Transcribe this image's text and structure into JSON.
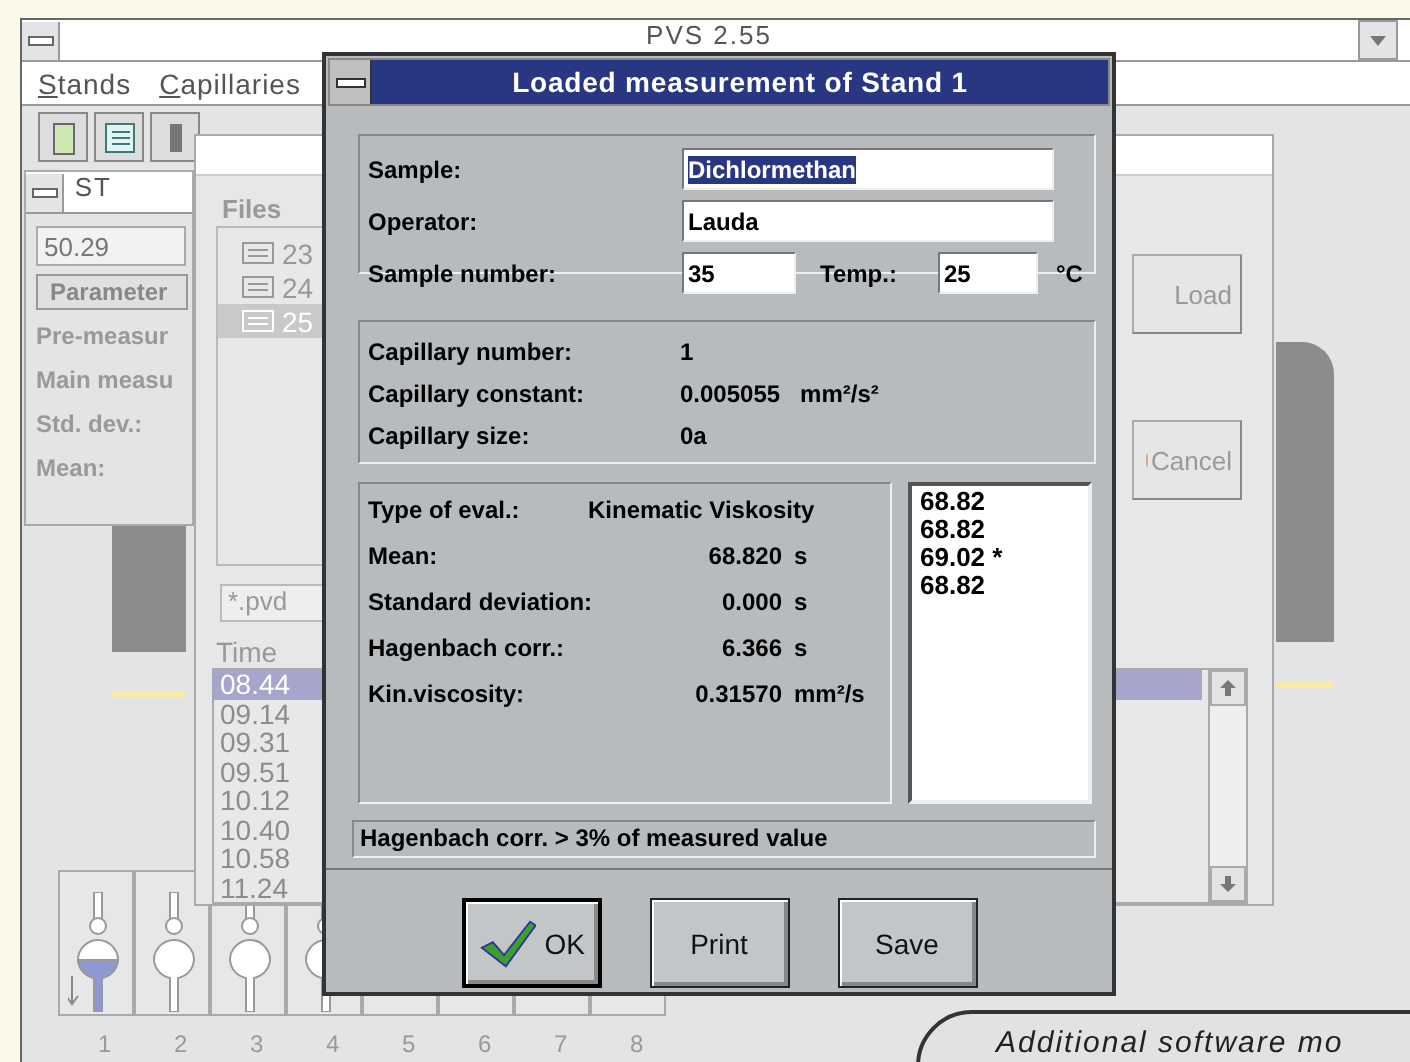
{
  "main_window": {
    "title": "PVS 2.55",
    "menu": [
      "Stands",
      "Capillaries"
    ]
  },
  "stand_window": {
    "title": "ST",
    "value": "50.29",
    "parameter_button": "Parameter",
    "labels": [
      "Pre-measur",
      "Main measu",
      "Std. dev.:",
      "Mean:"
    ]
  },
  "file_dialog": {
    "files_label": "Files",
    "files": [
      {
        "name": "23",
        "selected": false
      },
      {
        "name": "24",
        "selected": false
      },
      {
        "name": "25",
        "selected": true
      }
    ],
    "filter": "*.pvd",
    "time_label": "Time",
    "times": [
      {
        "label": "08.44",
        "selected": true
      },
      {
        "label": "09.14",
        "selected": false
      },
      {
        "label": "09.31",
        "selected": false
      },
      {
        "label": "09.51",
        "selected": false
      },
      {
        "label": "10.12",
        "selected": false
      },
      {
        "label": "10.40",
        "selected": false
      },
      {
        "label": "10.58",
        "selected": false
      },
      {
        "label": "11.24",
        "selected": false
      }
    ],
    "buttons": [
      {
        "kind": "load",
        "label": "Load"
      },
      {
        "kind": "cancel",
        "label": "Cancel"
      }
    ]
  },
  "dialog": {
    "title": "Loaded measurement of Stand 1",
    "sample": {
      "label": "Sample:",
      "value": "Dichlormethan"
    },
    "operator": {
      "label": "Operator:",
      "value": "Lauda"
    },
    "sample_number": {
      "label": "Sample number:",
      "value": "35"
    },
    "temperature": {
      "label": "Temp.:",
      "value": "25",
      "unit": "°C"
    },
    "capillary": [
      {
        "label": "Capillary number:",
        "value": "1"
      },
      {
        "label": "Capillary constant:",
        "value": "0.005055   mm²/s²"
      },
      {
        "label": "Capillary size:",
        "value": "0a"
      }
    ],
    "eval_type": {
      "label": "Type of eval.:",
      "value": "Kinematic Viskosity"
    },
    "results": [
      {
        "label": "Mean:",
        "value": "68.820",
        "unit": "s"
      },
      {
        "label": "Standard deviation:",
        "value": "0.000",
        "unit": "s"
      },
      {
        "label": "Hagenbach corr.:",
        "value": "6.366",
        "unit": "s"
      },
      {
        "label": "Kin.viscosity:",
        "value": "0.31570",
        "unit": "mm²/s"
      }
    ],
    "measurements": [
      "68.82",
      "68.82",
      "69.02 *",
      "68.82"
    ],
    "status": "Hagenbach corr. > 3% of measured value",
    "buttons": [
      {
        "kind": "ok",
        "label": "OK"
      },
      {
        "kind": "print",
        "label": "Print"
      },
      {
        "kind": "save",
        "label": "Save"
      }
    ]
  },
  "stands_strip": {
    "tubes": [
      {
        "filled": true
      },
      {
        "filled": false
      },
      {
        "filled": false
      },
      {
        "filled": false
      }
    ],
    "numbers": [
      "1",
      "2",
      "3",
      "4",
      "5",
      "6",
      "7",
      "8"
    ]
  },
  "caption": "Additional software mo"
}
